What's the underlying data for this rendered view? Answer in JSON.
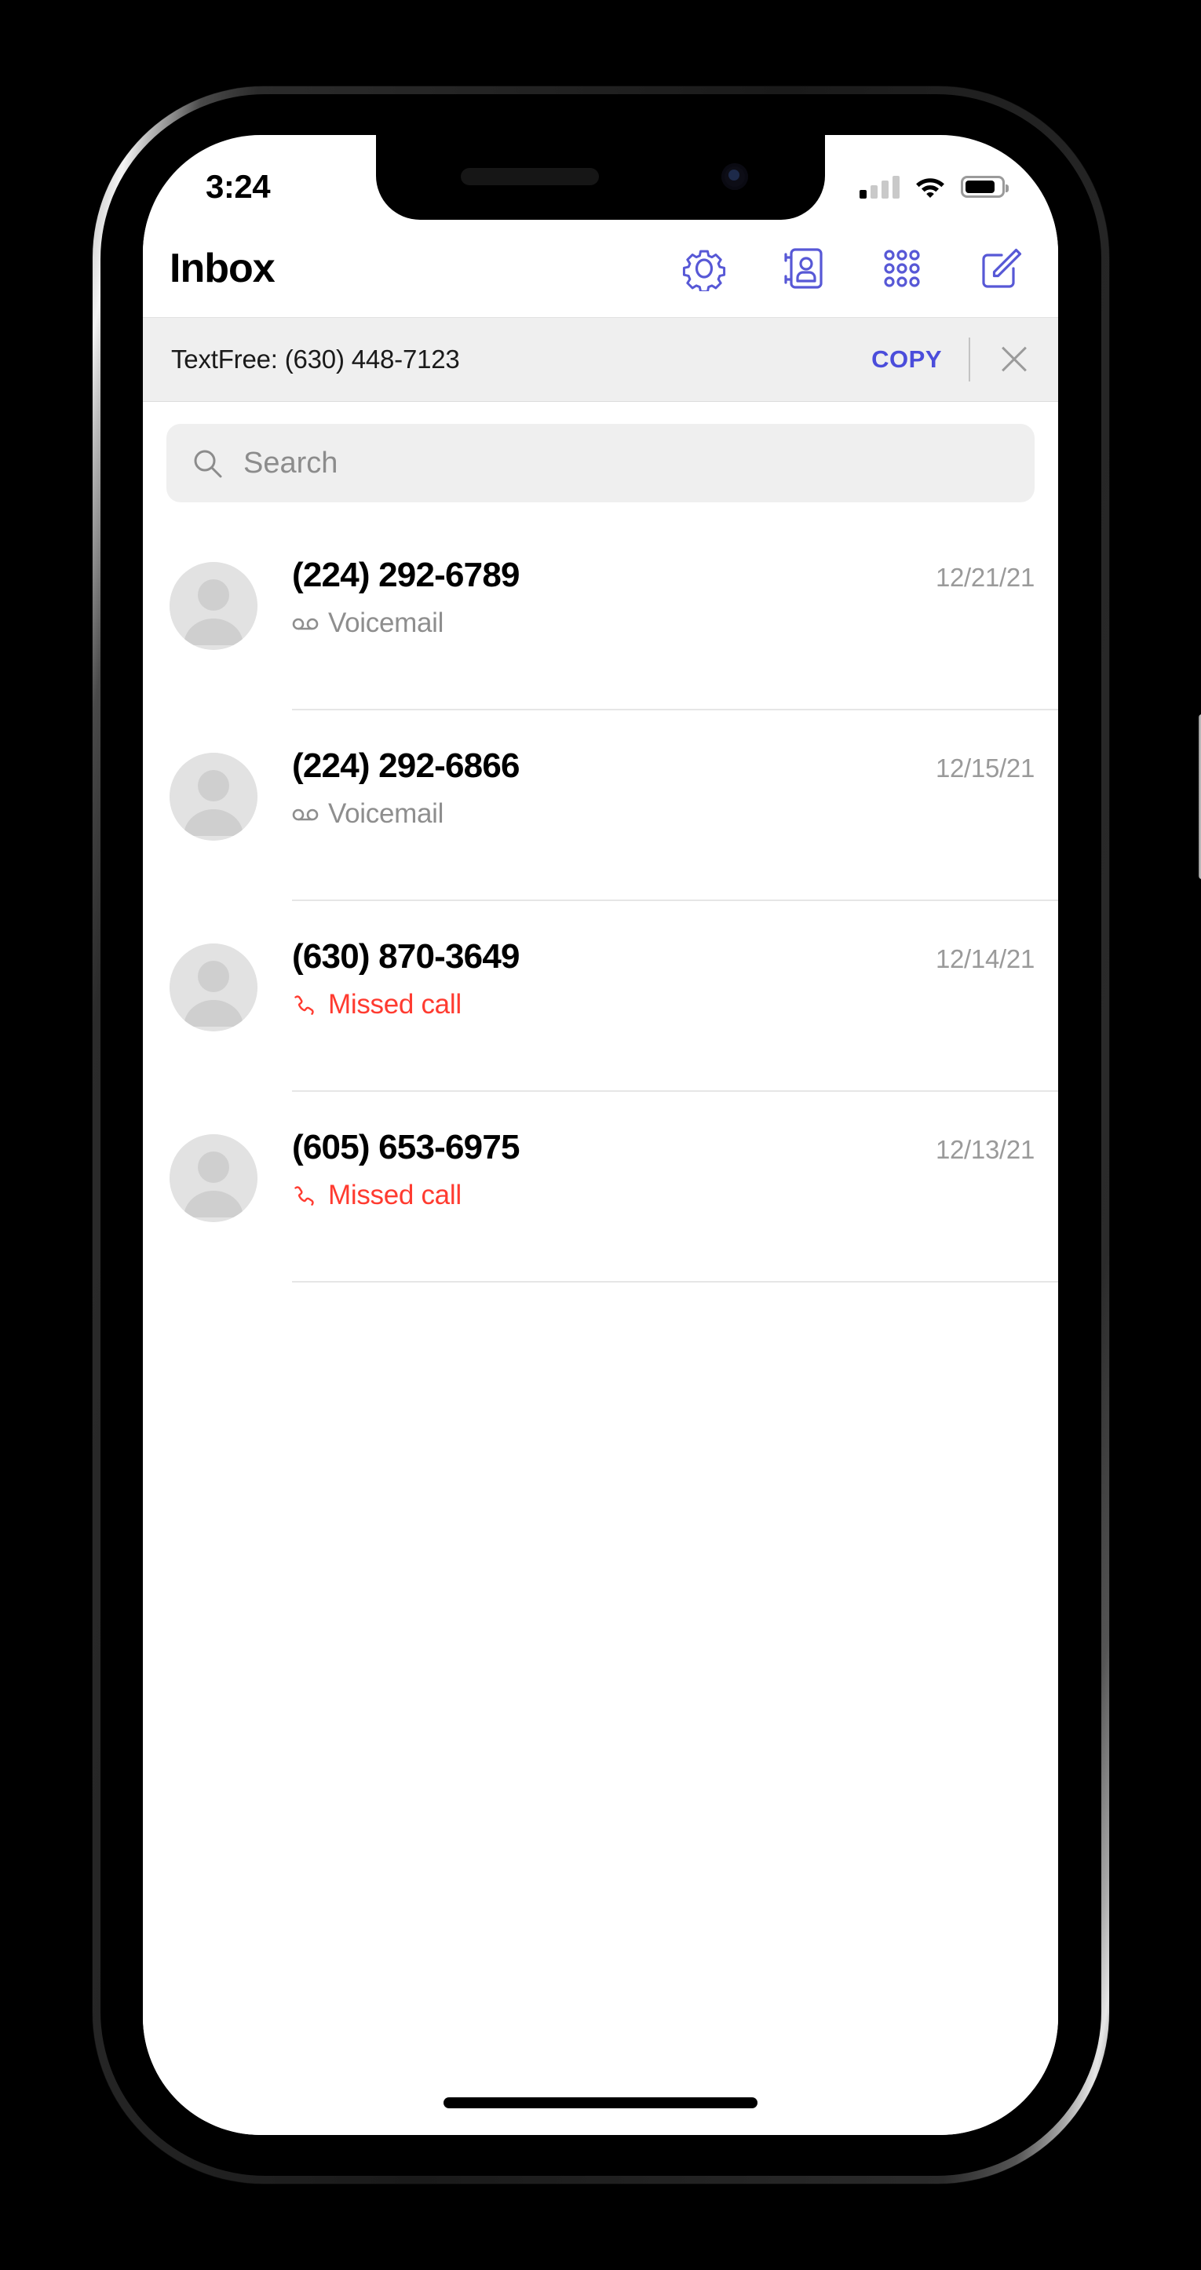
{
  "status_bar": {
    "time": "3:24",
    "signal_icon": "cellular-signal-icon",
    "signal_bars_filled": 1,
    "signal_bars_total": 4,
    "wifi_icon": "wifi-icon",
    "battery_icon": "battery-icon",
    "battery_level_pct": 84
  },
  "nav_bar": {
    "title": "Inbox",
    "actions": [
      {
        "name": "settings-button",
        "icon": "gear-icon"
      },
      {
        "name": "contacts-button",
        "icon": "contact-card-icon"
      },
      {
        "name": "keypad-button",
        "icon": "dial-pad-icon"
      },
      {
        "name": "compose-button",
        "icon": "compose-icon"
      }
    ]
  },
  "banner": {
    "text": "TextFree: (630) 448-7123",
    "copy_label": "COPY",
    "close_icon": "close-icon",
    "copy_color": "#4b4ddb",
    "background": "#efefef"
  },
  "search": {
    "placeholder": "Search",
    "value": "",
    "icon": "search-icon"
  },
  "conversations": [
    {
      "avatar": "default-avatar",
      "number": "(224) 292-6789",
      "preview": "Voicemail",
      "preview_type": "voicemail",
      "preview_icon": "voicemail-icon",
      "date": "12/21/21"
    },
    {
      "avatar": "default-avatar",
      "number": "(224) 292-6866",
      "preview": "Voicemail",
      "preview_type": "voicemail",
      "preview_icon": "voicemail-icon",
      "date": "12/15/21"
    },
    {
      "avatar": "default-avatar",
      "number": "(630) 870-3649",
      "preview": "Missed call",
      "preview_type": "missed",
      "preview_icon": "phone-handset-icon",
      "date": "12/14/21"
    },
    {
      "avatar": "default-avatar",
      "number": "(605) 653-6975",
      "preview": "Missed call",
      "preview_type": "missed",
      "preview_icon": "phone-handset-icon",
      "date": "12/13/21"
    }
  ],
  "colors": {
    "accent": "#4b4ddb",
    "missed_call": "#ff3b30",
    "muted_text": "#8e8e8e",
    "date_text": "#9a9a9a"
  },
  "home_indicator": "home-indicator"
}
